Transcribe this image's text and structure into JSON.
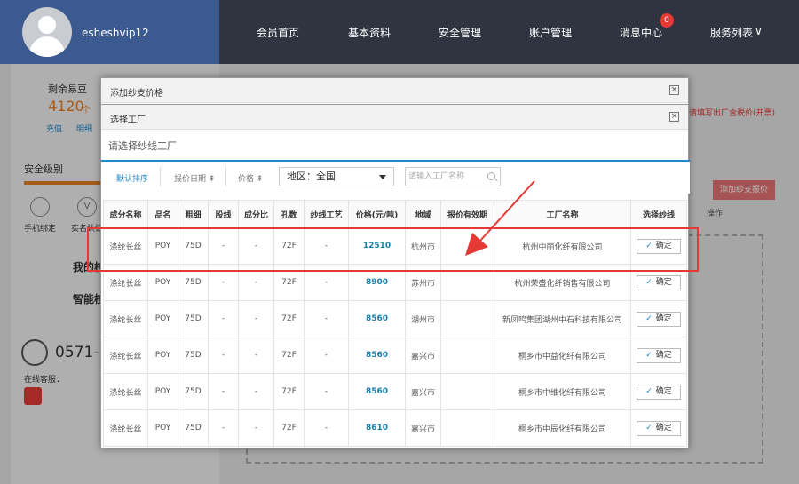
{
  "header": {
    "username": "esheshvip12",
    "nav": [
      "会员首页",
      "基本资料",
      "安全管理",
      "账户管理",
      "消息中心",
      "服务列表"
    ],
    "message_badge": "0",
    "nav_suffix": "∨"
  },
  "sidebar": {
    "bean_label": "剩余易豆",
    "bean_count": "4120",
    "bean_unit": "个",
    "recharge": "充值",
    "detail": "明细",
    "security_level": "安全级别",
    "phone_bind": "手机绑定",
    "realname": "实名认证",
    "my_item": "我的核",
    "smart_item": "智能核",
    "phone_prefix": "0571-",
    "online_service": "在线客服："
  },
  "background": {
    "hint": "请填写出厂含税价(开票)",
    "add_button": "添加纱支报价",
    "operation": "操作"
  },
  "modal_outer": {
    "title": "添加纱支价格"
  },
  "modal": {
    "title": "选择工厂",
    "subtitle": "请选择纱线工厂",
    "tabs": [
      "默认排序",
      "报价日期 ⇞",
      "价格 ⇞"
    ],
    "region_select": "地区：全国",
    "search_placeholder": "请输入工厂名称",
    "columns": [
      "成分名称",
      "品名",
      "粗细",
      "股线",
      "成分比",
      "孔数",
      "纱线工艺",
      "价格(元/吨)",
      "地域",
      "报价有效期",
      "工厂名称",
      "选择纱线"
    ],
    "rows": [
      [
        "涤纶长丝",
        "POY",
        "75D",
        "-",
        "-",
        "72F",
        "-",
        "12510",
        "杭州市",
        "",
        "杭州中丽化纤有限公司",
        "确定"
      ],
      [
        "涤纶长丝",
        "POY",
        "75D",
        "-",
        "-",
        "72F",
        "-",
        "8900",
        "苏州市",
        "",
        "杭州荣盛化纤销售有限公司",
        "确定"
      ],
      [
        "涤纶长丝",
        "POY",
        "75D",
        "-",
        "-",
        "72F",
        "-",
        "8560",
        "湖州市",
        "",
        "新凤鸣集团湖州中石科技有限公司",
        "确定"
      ],
      [
        "涤纶长丝",
        "POY",
        "75D",
        "-",
        "-",
        "72F",
        "-",
        "8560",
        "嘉兴市",
        "",
        "桐乡市中益化纤有限公司",
        "确定"
      ],
      [
        "涤纶长丝",
        "POY",
        "75D",
        "-",
        "-",
        "72F",
        "-",
        "8560",
        "嘉兴市",
        "",
        "桐乡市中维化纤有限公司",
        "确定"
      ],
      [
        "涤纶长丝",
        "POY",
        "75D",
        "-",
        "-",
        "72F",
        "-",
        "8610",
        "嘉兴市",
        "",
        "桐乡市中辰化纤有限公司",
        "确定"
      ]
    ]
  }
}
